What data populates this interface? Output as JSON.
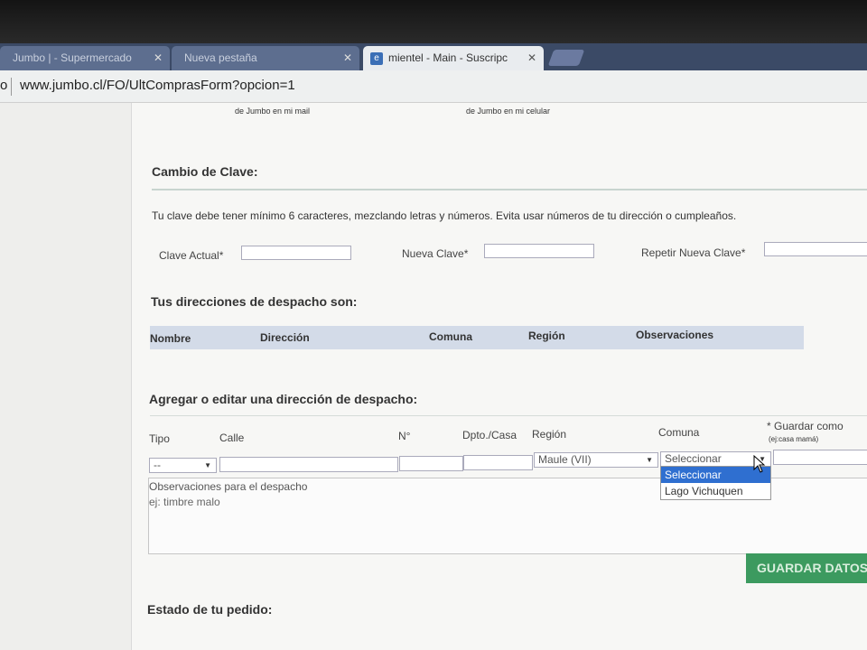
{
  "browser": {
    "tabs": [
      {
        "label": "Jumbo | - Supermercado",
        "close": "✕"
      },
      {
        "label": "Nueva pestaña",
        "close": "✕"
      },
      {
        "label": "mientel - Main - Suscripc",
        "close": "✕",
        "favicon": "e"
      }
    ],
    "url_prefix": "o",
    "url": "www.jumbo.cl/FO/UltComprasForm?opcion=1"
  },
  "page": {
    "notes": {
      "mail": "de Jumbo en mi mail",
      "celular": "de Jumbo en mi celular"
    },
    "cambio_clave": {
      "title": "Cambio de Clave:",
      "instructions": "Tu clave debe tener mínimo 6 caracteres, mezclando letras y números. Evita usar números de tu dirección o cumpleaños.",
      "clave_actual_label": "Clave Actual*",
      "nueva_clave_label": "Nueva Clave*",
      "repetir_label": "Repetir Nueva Clave*"
    },
    "direcciones": {
      "title": "Tus direcciones de despacho son:",
      "columns": [
        "Nombre",
        "Dirección",
        "Comuna",
        "Región",
        "Observaciones"
      ]
    },
    "agregar": {
      "title": "Agregar o editar una dirección de despacho:",
      "labels": {
        "tipo": "Tipo",
        "calle": "Calle",
        "numero": "N°",
        "dpto": "Dpto./Casa",
        "region": "Región",
        "comuna": "Comuna",
        "guardar_como": "* Guardar como",
        "guardar_hint": "(ej:casa mamá)"
      },
      "tipo_value": "--",
      "region_value": "Maule (VII)",
      "comuna_value": "Seleccionar",
      "comuna_options": [
        "Seleccionar",
        "Lago Vichuquen"
      ],
      "observaciones_label": "Observaciones para el despacho",
      "observaciones_placeholder": "ej: timbre malo",
      "save_button": "GUARDAR DATOS"
    },
    "estado": {
      "title": "Estado de tu pedido:"
    }
  },
  "colors": {
    "tabstrip": "#3b4a66",
    "table_header": "#d3dbe8",
    "save_button": "#3c9a5f",
    "dropdown_highlight": "#2f6fd0"
  }
}
